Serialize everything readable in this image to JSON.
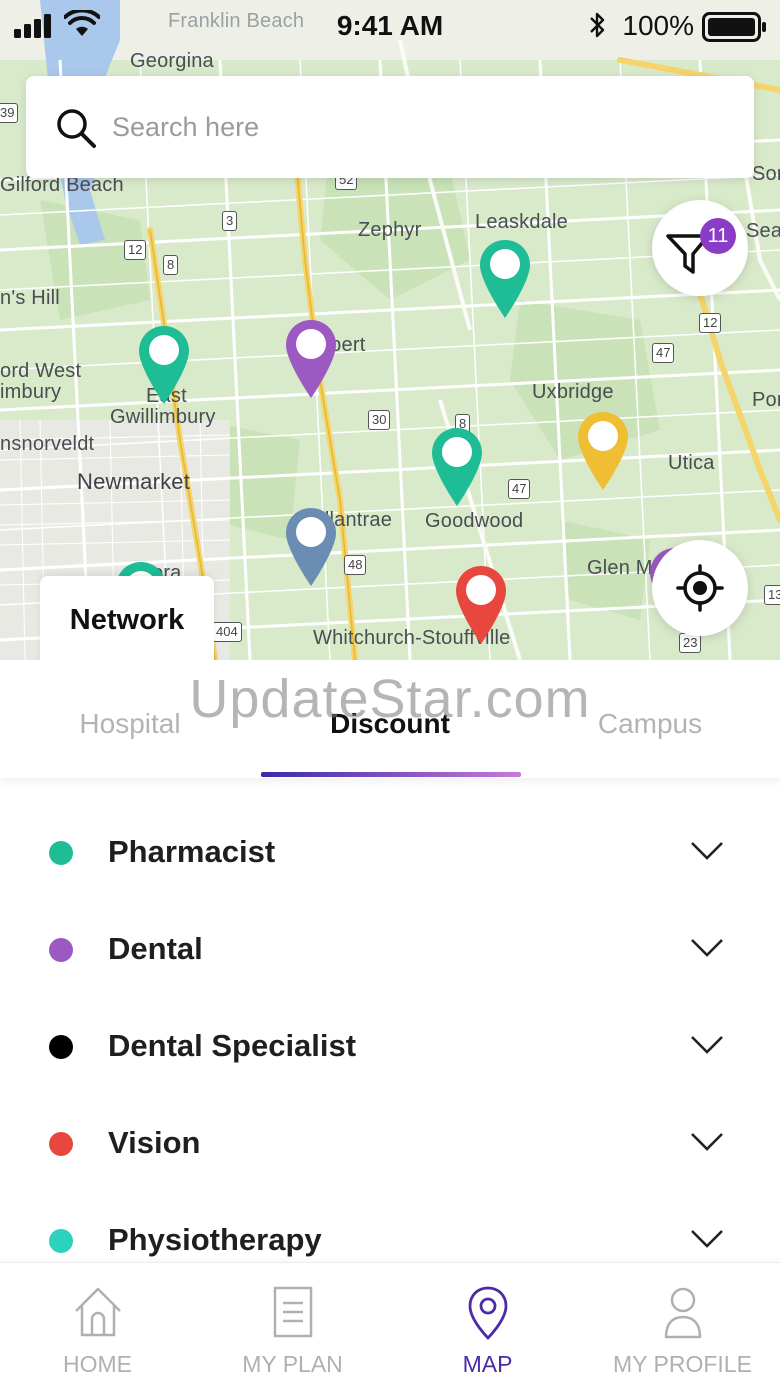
{
  "status_bar": {
    "time": "9:41 AM",
    "battery": "100%"
  },
  "search": {
    "placeholder": "Search here"
  },
  "filter": {
    "badge_count": "11"
  },
  "map": {
    "labels": [
      "Franklin Beach",
      "Georgina",
      "Gilford Beach",
      "Zephyr",
      "Leaskdale",
      "Sea",
      "Sor",
      "n's Hill",
      "Albert",
      "Uxbridge",
      "Por",
      "ord West",
      "imbury",
      "East",
      "Gwillimbury",
      "nsnorveldt",
      "Newmarket",
      "Utica",
      "Ballantrae",
      "Goodwood",
      "Glen M",
      "ora",
      "Whitchurch-Stouffville"
    ],
    "road_shields": [
      "39",
      "52",
      "3",
      "12",
      "8",
      "12",
      "47",
      "30",
      "8",
      "47",
      "48",
      "404",
      "23",
      "13"
    ]
  },
  "network": {
    "label": "Network"
  },
  "watermark": "UpdateStar.com",
  "tabs": [
    {
      "label": "Hospital",
      "active": false
    },
    {
      "label": "Discount",
      "active": true
    },
    {
      "label": "Campus",
      "active": false
    }
  ],
  "categories": [
    {
      "label": "Pharmacist",
      "color": "#1fbd96"
    },
    {
      "label": "Dental",
      "color": "#9c59c2"
    },
    {
      "label": "Dental Specialist",
      "color": "#000000"
    },
    {
      "label": "Vision",
      "color": "#e8473e"
    },
    {
      "label": "Physiotherapy",
      "color": "#2dd1bf"
    }
  ],
  "pin_colors": {
    "green": "#1fbd96",
    "purple": "#9c59c2",
    "blue": "#6b8db3",
    "yellow": "#f0be33",
    "red": "#e8473e"
  },
  "nav": [
    {
      "label": "HOME",
      "icon": "home-icon",
      "active": false
    },
    {
      "label": "MY PLAN",
      "icon": "document-icon",
      "active": false
    },
    {
      "label": "MAP",
      "icon": "map-pin-icon",
      "active": true
    },
    {
      "label": "MY PROFILE",
      "icon": "user-icon",
      "active": false
    }
  ],
  "accent_color": "#4d2aa6"
}
